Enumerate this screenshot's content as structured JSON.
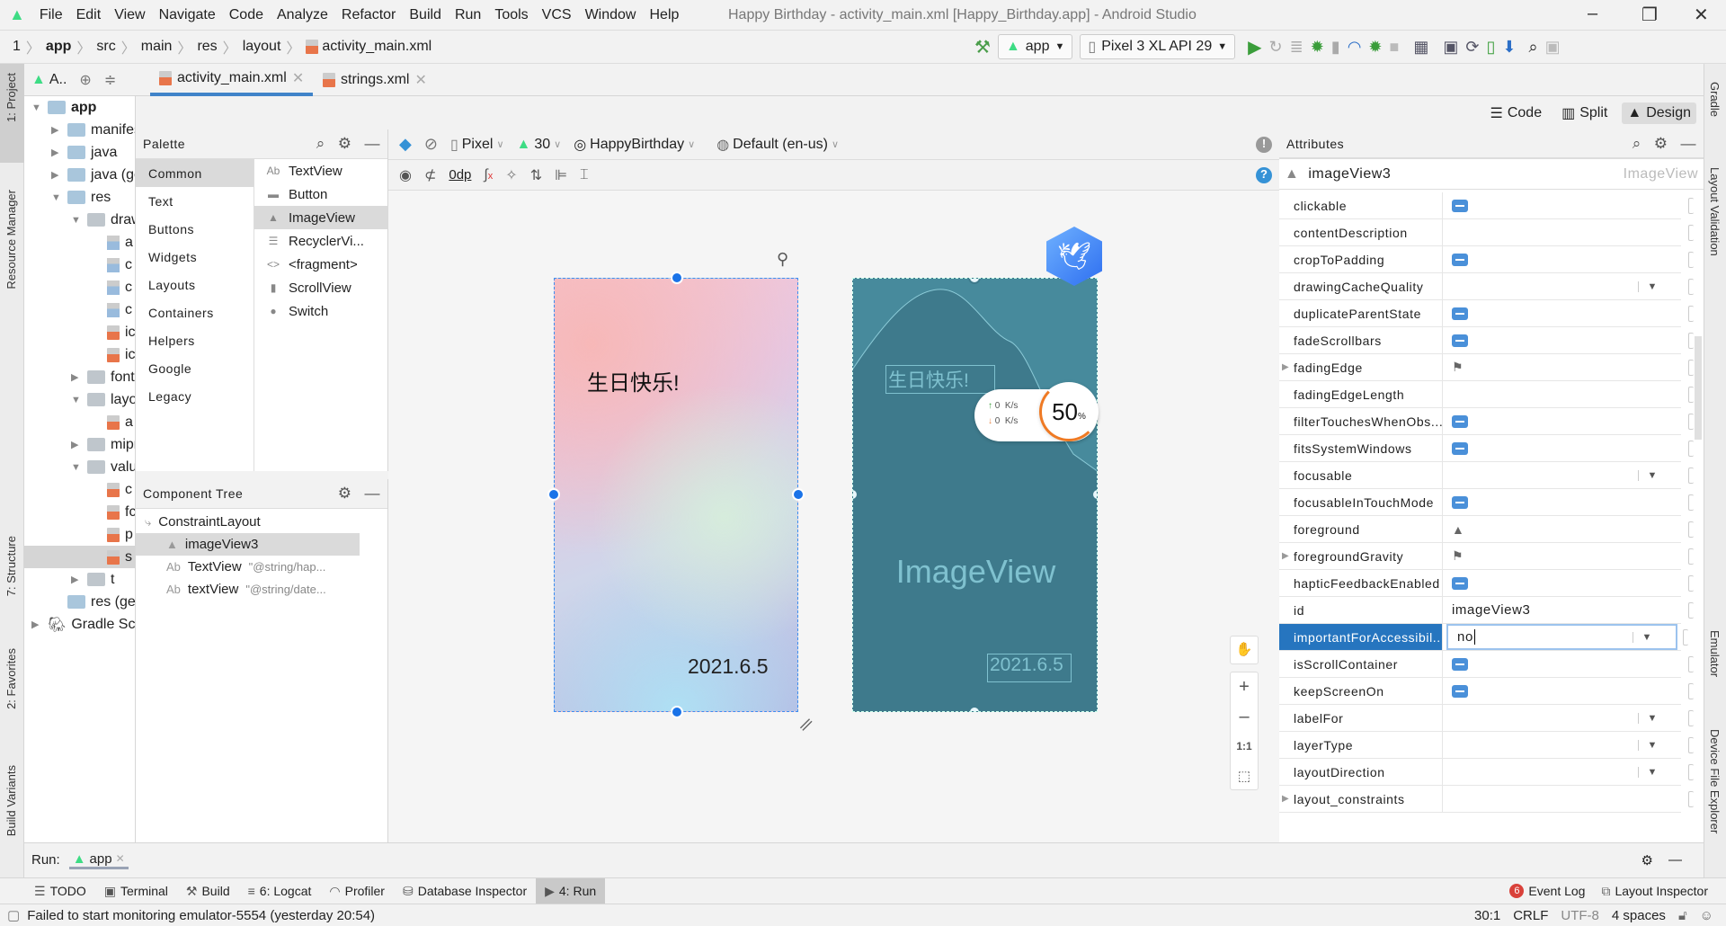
{
  "menu": [
    "File",
    "Edit",
    "View",
    "Navigate",
    "Code",
    "Analyze",
    "Refactor",
    "Build",
    "Run",
    "Tools",
    "VCS",
    "Window",
    "Help"
  ],
  "window_title": "Happy Birthday - activity_main.xml [Happy_Birthday.app] - Android Studio",
  "breadcrumb": [
    "1",
    "app",
    "src",
    "main",
    "res",
    "layout",
    "activity_main.xml"
  ],
  "toolbar": {
    "run_config": "app",
    "device": "Pixel 3 XL API 29"
  },
  "left_strip": [
    "1: Project",
    "Resource Manager",
    "7: Structure",
    "2: Favorites",
    "Build Variants"
  ],
  "right_strip": [
    "Gradle",
    "Layout Validation",
    "Emulator",
    "Device File Explorer"
  ],
  "project_selector": "A..",
  "editor_tabs": [
    {
      "label": "activity_main.xml",
      "active": true
    },
    {
      "label": "strings.xml",
      "active": false
    }
  ],
  "project_tree": [
    {
      "label": "app",
      "level": 0,
      "icon": "module",
      "arrow": "down",
      "bold": true
    },
    {
      "label": "manifests",
      "level": 1,
      "icon": "folder",
      "arrow": "right"
    },
    {
      "label": "java",
      "level": 1,
      "icon": "folder",
      "arrow": "right"
    },
    {
      "label": "java (ge",
      "level": 1,
      "icon": "folder",
      "arrow": "right"
    },
    {
      "label": "res",
      "level": 1,
      "icon": "res-folder",
      "arrow": "down"
    },
    {
      "label": "draw",
      "level": 2,
      "icon": "folder-gray",
      "arrow": "down"
    },
    {
      "label": "a",
      "level": 3,
      "icon": "image-file"
    },
    {
      "label": "c",
      "level": 3,
      "icon": "image-file"
    },
    {
      "label": "c",
      "level": 3,
      "icon": "image-file"
    },
    {
      "label": "c",
      "level": 3,
      "icon": "image-file"
    },
    {
      "label": "ic",
      "level": 3,
      "icon": "xml-file"
    },
    {
      "label": "ic",
      "level": 3,
      "icon": "xml-file"
    },
    {
      "label": "font",
      "level": 2,
      "icon": "folder-gray",
      "arrow": "right"
    },
    {
      "label": "layo",
      "level": 2,
      "icon": "folder-gray",
      "arrow": "down"
    },
    {
      "label": "a",
      "level": 3,
      "icon": "xml-file"
    },
    {
      "label": "mipr",
      "level": 2,
      "icon": "folder-gray",
      "arrow": "right"
    },
    {
      "label": "valu",
      "level": 2,
      "icon": "folder-gray",
      "arrow": "down"
    },
    {
      "label": "c",
      "level": 3,
      "icon": "xml-file"
    },
    {
      "label": "fc",
      "level": 3,
      "icon": "xml-file"
    },
    {
      "label": "p",
      "level": 3,
      "icon": "xml-file"
    },
    {
      "label": "s",
      "level": 3,
      "icon": "xml-file",
      "selected": true
    },
    {
      "label": "t",
      "level": 2,
      "icon": "folder-gray",
      "arrow": "right"
    },
    {
      "label": "res (ge",
      "level": 1,
      "icon": "res-folder"
    },
    {
      "label": "Gradle Scr",
      "level": 0,
      "icon": "gradle",
      "arrow": "right"
    }
  ],
  "palette": {
    "title": "Palette",
    "categories": [
      "Common",
      "Text",
      "Buttons",
      "Widgets",
      "Layouts",
      "Containers",
      "Helpers",
      "Google",
      "Legacy"
    ],
    "selected_category": "Common",
    "items": [
      {
        "label": "TextView",
        "icon": "Ab"
      },
      {
        "label": "Button",
        "icon": "▬"
      },
      {
        "label": "ImageView",
        "icon": "▲",
        "selected": true
      },
      {
        "label": "RecyclerVi...",
        "icon": "☰"
      },
      {
        "label": "<fragment>",
        "icon": "<>"
      },
      {
        "label": "ScrollView",
        "icon": "▮"
      },
      {
        "label": "Switch",
        "icon": "●"
      }
    ]
  },
  "component_tree": {
    "title": "Component Tree",
    "nodes": [
      {
        "label": "ConstraintLayout",
        "hint": "",
        "level": 0,
        "icon": "⤷"
      },
      {
        "label": "imageView3",
        "hint": "",
        "level": 1,
        "icon": "▲",
        "selected": true
      },
      {
        "label": "TextView",
        "hint": "\"@string/hap...",
        "level": 1,
        "icon": "Ab"
      },
      {
        "label": "textView",
        "hint": "\"@string/date...",
        "level": 1,
        "icon": "Ab"
      }
    ]
  },
  "design_toolbar": {
    "device": "Pixel",
    "api": "30",
    "theme": "HappyBirthday",
    "locale": "Default (en-us)",
    "margin": "0dp"
  },
  "view_modes": [
    {
      "label": "Code"
    },
    {
      "label": "Split"
    },
    {
      "label": "Design",
      "selected": true
    }
  ],
  "design_preview": {
    "title": "生日快乐!",
    "date": "2021.6.5"
  },
  "blueprint": {
    "title": "生日快乐!",
    "date": "2021.6.5",
    "placeholder": "ImageView"
  },
  "overlay_widget": {
    "upload": "0",
    "download": "0",
    "unit": "K/s",
    "percent": "50",
    "percent_sign": "%"
  },
  "zoom_controls": {
    "fit_label": "1:1"
  },
  "attributes": {
    "title": "Attributes",
    "component_id": "imageView3",
    "component_type": "ImageView",
    "rows": [
      {
        "name": "clickable",
        "type": "toggle"
      },
      {
        "name": "contentDescription",
        "type": "empty"
      },
      {
        "name": "cropToPadding",
        "type": "toggle"
      },
      {
        "name": "drawingCacheQuality",
        "type": "dropdown"
      },
      {
        "name": "duplicateParentState",
        "type": "toggle"
      },
      {
        "name": "fadeScrollbars",
        "type": "toggle"
      },
      {
        "name": "fadingEdge",
        "type": "flag",
        "expandable": true
      },
      {
        "name": "fadingEdgeLength",
        "type": "empty"
      },
      {
        "name": "filterTouchesWhenObs...",
        "type": "toggle"
      },
      {
        "name": "fitsSystemWindows",
        "type": "toggle"
      },
      {
        "name": "focusable",
        "type": "dropdown"
      },
      {
        "name": "focusableInTouchMode",
        "type": "toggle"
      },
      {
        "name": "foreground",
        "type": "image"
      },
      {
        "name": "foregroundGravity",
        "type": "flag",
        "expandable": true
      },
      {
        "name": "hapticFeedbackEnabled",
        "type": "toggle"
      },
      {
        "name": "id",
        "type": "text",
        "value": "imageView3"
      },
      {
        "name": "importantForAccessibil...",
        "type": "input-dropdown",
        "value": "no",
        "selected": true
      },
      {
        "name": "isScrollContainer",
        "type": "toggle"
      },
      {
        "name": "keepScreenOn",
        "type": "toggle"
      },
      {
        "name": "labelFor",
        "type": "dropdown"
      },
      {
        "name": "layerType",
        "type": "dropdown"
      },
      {
        "name": "layoutDirection",
        "type": "dropdown"
      },
      {
        "name": "layout_constraints",
        "type": "empty",
        "expandable": true
      }
    ]
  },
  "run_panel": {
    "label": "Run:",
    "config": "app"
  },
  "tool_windows": [
    {
      "label": "TODO",
      "icon": "☰"
    },
    {
      "label": "Terminal",
      "icon": "▣"
    },
    {
      "label": "Build",
      "icon": "⚒"
    },
    {
      "label": "6: Logcat",
      "icon": "≡"
    },
    {
      "label": "Profiler",
      "icon": "◠"
    },
    {
      "label": "Database Inspector",
      "icon": "⛁"
    },
    {
      "label": "4: Run",
      "icon": "▶",
      "selected": true
    }
  ],
  "right_tool_windows": [
    {
      "label": "Event Log",
      "badge": "6"
    },
    {
      "label": "Layout Inspector"
    }
  ],
  "status": {
    "message": "Failed to start monitoring emulator-5554 (yesterday 20:54)",
    "position": "30:1",
    "line_sep": "CRLF",
    "encoding": "UTF-8",
    "indent": "4 spaces"
  },
  "colors": {
    "accent": "#2675bf",
    "toggle": "#4a90d9",
    "blueprint": "#3e7a8c",
    "android_green": "#3ddc84"
  }
}
